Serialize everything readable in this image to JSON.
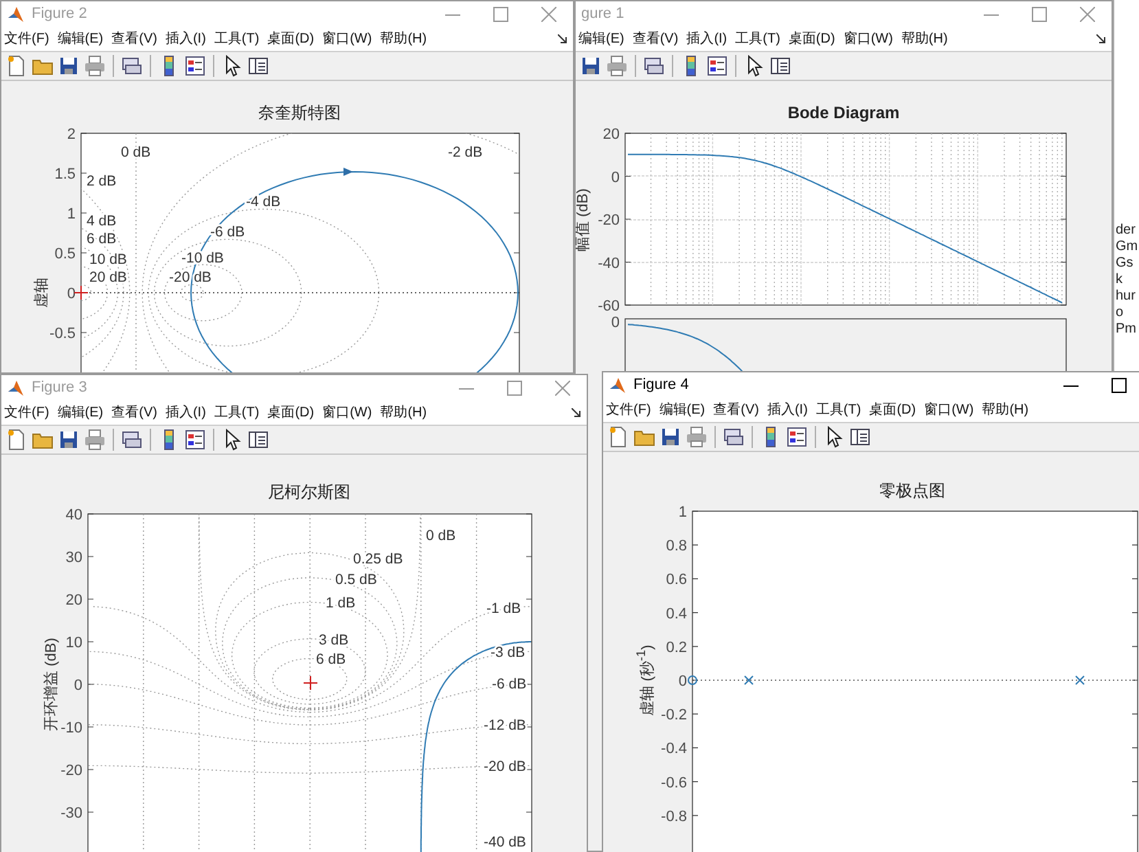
{
  "windows": [
    {
      "kind": "bode",
      "title": "gure 1",
      "active": false,
      "menu": [
        "编辑(E)",
        "查看(V)",
        "插入(I)",
        "工具(T)",
        "桌面(D)",
        "窗口(W)",
        "帮助(H)"
      ],
      "plot": {
        "title": "Bode Diagram",
        "ylabel": "幅值 (dB)",
        "yticks": [
          "20",
          "0",
          "-20",
          "-40",
          "-60"
        ],
        "phase_yticks": [
          "0"
        ]
      }
    },
    {
      "kind": "nyquist",
      "title": "Figure 2",
      "active": false,
      "menu": [
        "文件(F)",
        "编辑(E)",
        "查看(V)",
        "插入(I)",
        "工具(T)",
        "桌面(D)",
        "窗口(W)",
        "帮助(H)"
      ],
      "plot": {
        "title": "奈奎斯特图",
        "ylabel": "虚轴",
        "yticks": [
          "2",
          "1.5",
          "1",
          "0.5",
          "0",
          "-0.5"
        ],
        "grid_labels": [
          "0 dB",
          "-2 dB",
          "2 dB",
          "-4 dB",
          "4 dB",
          "-6 dB",
          "6 dB",
          "10 dB",
          "-10 dB",
          "20 dB",
          "-20 dB"
        ]
      }
    },
    {
      "kind": "nichols",
      "title": "Figure 3",
      "active": false,
      "menu": [
        "文件(F)",
        "编辑(E)",
        "查看(V)",
        "插入(I)",
        "工具(T)",
        "桌面(D)",
        "窗口(W)",
        "帮助(H)"
      ],
      "plot": {
        "title": "尼柯尔斯图",
        "ylabel": "开环增益 (dB)",
        "yticks": [
          "40",
          "30",
          "20",
          "10",
          "0",
          "-10",
          "-20",
          "-30"
        ],
        "grid_labels": [
          "0 dB",
          "0.25 dB",
          "0.5 dB",
          "1 dB",
          "3 dB",
          "6 dB",
          "-1 dB",
          "-3 dB",
          "-6 dB",
          "-12 dB",
          "-20 dB",
          "-40 dB"
        ]
      }
    },
    {
      "kind": "pzmap",
      "title": "Figure 4",
      "active": true,
      "menu": [
        "文件(F)",
        "编辑(E)",
        "查看(V)",
        "插入(I)",
        "工具(T)",
        "桌面(D)",
        "窗口(W)",
        "帮助(H)"
      ],
      "plot": {
        "title": "零极点图",
        "ylabel": "虚轴 (秒$^{-1}$)",
        "yticks": [
          "1",
          "0.8",
          "0.6",
          "0.4",
          "0.2",
          "0",
          "-0.2",
          "-0.4",
          "-0.6",
          "-0.8"
        ]
      }
    }
  ],
  "side_panel_fragments": [
    "der",
    "Gm",
    "Gs",
    "k",
    "hur",
    "o",
    "Pm"
  ]
}
